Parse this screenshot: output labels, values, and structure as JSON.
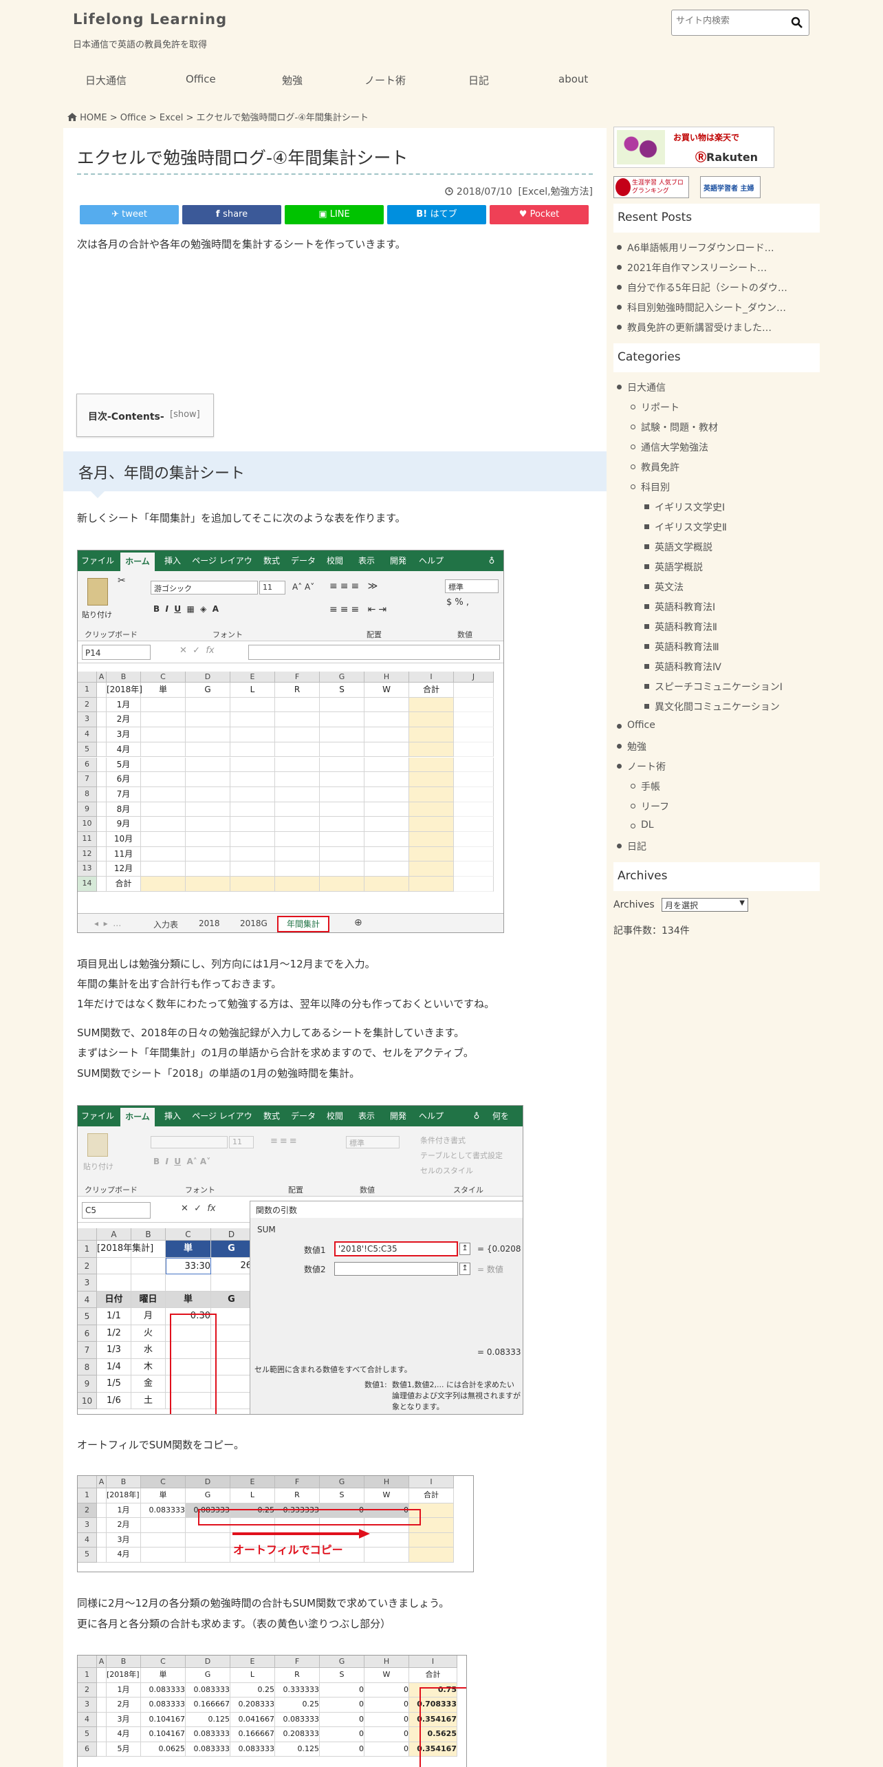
{
  "site": {
    "title": "Lifelong Learning",
    "description": "日本通信で英語の教員免許を取得"
  },
  "search": {
    "placeholder": "サイト内検索"
  },
  "nav": [
    "日大通信",
    "Office",
    "勉強",
    "ノート術",
    "日記",
    "about"
  ],
  "breadcrumb": {
    "home": "HOME",
    "items": [
      "Office",
      "Excel",
      "エクセルで勉強時間ログ-④年間集計シート"
    ]
  },
  "post": {
    "title": "エクセルで勉強時間ログ-④年間集計シート",
    "date": "2018/07/10",
    "categories": "[Excel,勉強方法]",
    "share": {
      "twitter": "tweet",
      "facebook": "share",
      "line": "LINE",
      "hatena": "はてブ",
      "pocket": "Pocket"
    },
    "intro": "次は各月の合計や各年の勉強時間を集計するシートを作っていきます。",
    "toc_title": "目次-Contents-",
    "toc_toggle": "[show]",
    "h2": "各月、年間の集計シート",
    "p1": "新しくシート「年間集計」を追加してそこに次のような表を作ります。",
    "p2": [
      "項目見出しは勉強分類にし、列方向には1月～12月までを入力。",
      "年間の集計を出す合計行も作っておきます。",
      "1年だけではなく数年にわたって勉強する方は、翌年以降の分も作っておくといいですね。"
    ],
    "p3": [
      "SUM関数で、2018年の日々の勉強記録が入力してあるシートを集計していきます。",
      "まずはシート「年間集計」の1月の単語から合計を求めますので、セルをアクティブ。",
      "SUM関数でシート「2018」の単語の1月の勉強時間を集計。"
    ],
    "p4": "オートフィルでSUM関数をコピー。",
    "p5": [
      "同様に2月～12月の各分類の勉強時間の合計もSUM関数で求めていきましょう。",
      "更に各月と各分類の合計も求めます。（表の黄色い塗りつぶし部分）"
    ]
  },
  "excel": {
    "tabs": [
      "ファイル",
      "ホーム",
      "挿入",
      "ページ レイアウト",
      "数式",
      "データ",
      "校閲",
      "表示",
      "開発",
      "ヘルプ"
    ],
    "tabs2_extra": "何を",
    "font_name": "游ゴシック",
    "font_size": "11",
    "number_format": "標準",
    "groups": [
      "クリップボード",
      "フォント",
      "配置",
      "数値"
    ],
    "groups2_style": "スタイル",
    "style_items": [
      "条件付き書式",
      "テーブルとして書式設定",
      "セルのスタイル"
    ],
    "paste": "貼り付け",
    "namebox1": "P14",
    "namebox2": "C5",
    "cols": [
      "A",
      "B",
      "C",
      "D",
      "E",
      "F",
      "G",
      "H",
      "I",
      "J"
    ],
    "head_row": [
      "[2018年]",
      "単",
      "G",
      "L",
      "R",
      "S",
      "W",
      "合計"
    ],
    "months": [
      "1月",
      "2月",
      "3月",
      "4月",
      "5月",
      "6月",
      "7月",
      "8月",
      "9月",
      "10月",
      "11月",
      "12月"
    ],
    "total_label": "合計",
    "sheet_tabs": [
      "入力表",
      "2018",
      "2018G",
      "年間集計"
    ],
    "dialog": {
      "title": "関数の引数",
      "func": "SUM",
      "arg1_label": "数値1",
      "arg1_value": "'2018'!C5:C35",
      "arg1_result": "= {0.0208",
      "arg2_label": "数値2",
      "arg2_result": "= 数値",
      "total_result": "= 0.08333",
      "desc": "セル範囲に含まれる数値をすべて合計します。",
      "arg_desc_label": "数値1:",
      "arg_desc": [
        "数値1,数値2,... には合計を求めたい",
        "論理値および文字列は無視されますが",
        "象となります。"
      ]
    },
    "s2_head": [
      "[2018年集計]",
      "単",
      "G"
    ],
    "s2_row2": [
      "",
      "33:30",
      "26"
    ],
    "s2_row4": [
      "日付",
      "曜日",
      "単",
      "G"
    ],
    "s2_dates": [
      "1/1",
      "1/2",
      "1/3",
      "1/4",
      "1/5",
      "1/6"
    ],
    "s2_days": [
      "月",
      "火",
      "水",
      "木",
      "金",
      "土"
    ],
    "s2_c5": "0:30",
    "s3_jan": [
      "0.083333",
      "0.083333",
      "0.25",
      "0.333333",
      "0",
      "0"
    ],
    "s3_months": [
      "1月",
      "2月",
      "3月",
      "4月"
    ],
    "s3_annotation": "オートフィルでコピー",
    "s4_rows": [
      [
        "1月",
        "0.083333",
        "0.083333",
        "0.25",
        "0.333333",
        "0",
        "0",
        "0.75"
      ],
      [
        "2月",
        "0.083333",
        "0.166667",
        "0.208333",
        "0.25",
        "0",
        "0",
        "0.708333"
      ],
      [
        "3月",
        "0.104167",
        "0.125",
        "0.041667",
        "0.083333",
        "0",
        "0",
        "0.354167"
      ],
      [
        "4月",
        "0.104167",
        "0.083333",
        "0.166667",
        "0.208333",
        "0",
        "0",
        "0.5625"
      ],
      [
        "5月",
        "0.0625",
        "0.083333",
        "0.083333",
        "0.125",
        "0",
        "0",
        "0.354167"
      ]
    ]
  },
  "sidebar": {
    "banner1": "お買い物は楽天で",
    "banner1_brand": "Rakuten",
    "banner2": "生涯学習 人気ブログランキング",
    "banner3": "英語学習者 主婦",
    "recent_title": "Resent Posts",
    "recent": [
      "A6単語帳用リーフダウンロード…",
      "2021年自作マンスリーシート…",
      "自分で作る5年日記（シートのダウ…",
      "科目別勉強時間記入シート_ダウン…",
      "教員免許の更新講習受けました…"
    ],
    "categories_title": "Categories",
    "categories": [
      {
        "label": "日大通信",
        "level": 0
      },
      {
        "label": "リポート",
        "level": 1
      },
      {
        "label": "試験・問題・教材",
        "level": 1
      },
      {
        "label": "通信大学勉強法",
        "level": 1
      },
      {
        "label": "教員免許",
        "level": 1
      },
      {
        "label": "科目別",
        "level": 1
      },
      {
        "label": "イギリス文学史Ⅰ",
        "level": 2
      },
      {
        "label": "イギリス文学史Ⅱ",
        "level": 2
      },
      {
        "label": "英語文学概説",
        "level": 2
      },
      {
        "label": "英語学概説",
        "level": 2
      },
      {
        "label": "英文法",
        "level": 2
      },
      {
        "label": "英語科教育法Ⅰ",
        "level": 2
      },
      {
        "label": "英語科教育法Ⅱ",
        "level": 2
      },
      {
        "label": "英語科教育法Ⅲ",
        "level": 2
      },
      {
        "label": "英語科教育法Ⅳ",
        "level": 2
      },
      {
        "label": "スピーチコミュニケーションⅠ",
        "level": 2
      },
      {
        "label": "異文化間コミュニケーション",
        "level": 2
      },
      {
        "label": "Office",
        "level": 0
      },
      {
        "label": "勉強",
        "level": 0
      },
      {
        "label": "ノート術",
        "level": 0
      },
      {
        "label": "手帳",
        "level": 1
      },
      {
        "label": "リーフ",
        "level": 1
      },
      {
        "label": "DL",
        "level": 1
      },
      {
        "label": "日記",
        "level": 0
      }
    ],
    "archives_title": "Archives",
    "archives_label": "Archives",
    "archives_select": "月を選択",
    "post_count": "記事件数：134件"
  },
  "colors": {
    "excel_green": "#217346",
    "twitter": "#55acee",
    "facebook": "#3b5998",
    "line": "#00c300",
    "hatena": "#008fde",
    "pocket": "#ef4056",
    "highlight": "#e0101c"
  }
}
